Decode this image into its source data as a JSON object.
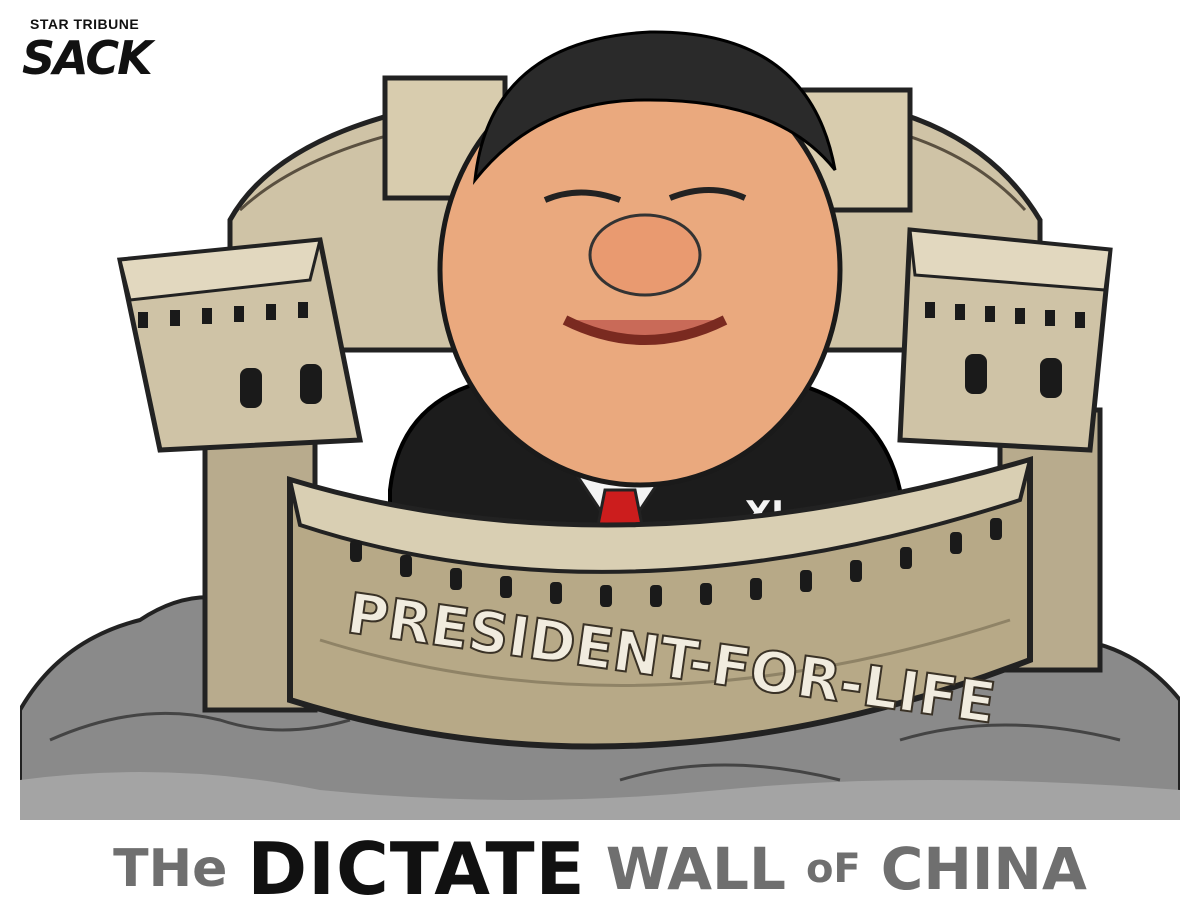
{
  "masthead": {
    "paper": "STAR TRIBUNE",
    "artist": "SACK"
  },
  "cartoon": {
    "banner_text": "PRESIDENT-FOR-LIFE",
    "lapel_text": "XI"
  },
  "caption": {
    "word_the": "THe",
    "word_dictate": "DICTATE",
    "word_wall": "WALL",
    "word_of": "oF",
    "word_china": "CHINA"
  },
  "colors": {
    "wall_stone": "#cfc3a6",
    "wall_shadow": "#8f8366",
    "rock": "#7d7d7d",
    "skin": "#eaa97e",
    "suit": "#1c1c1c",
    "tie": "#cc1d1d",
    "caption_gray": "#6f6f6f"
  }
}
